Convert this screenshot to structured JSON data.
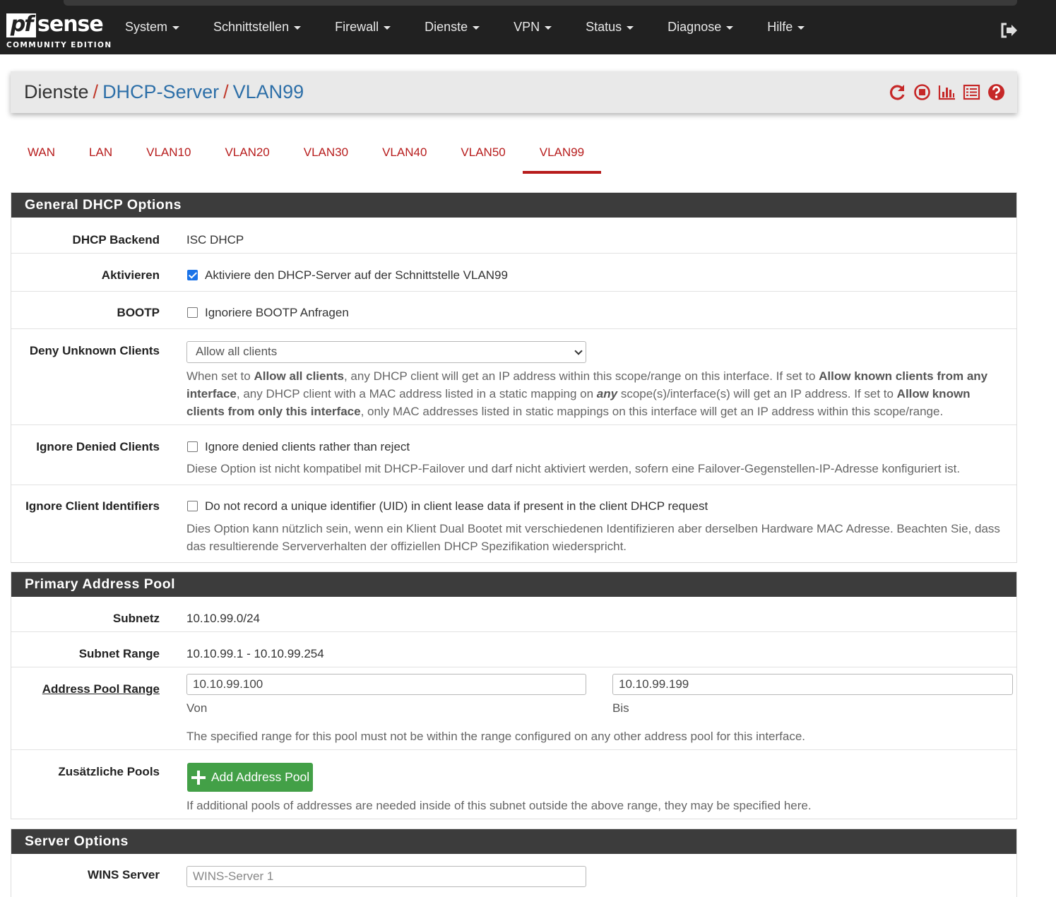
{
  "brand": {
    "logo_pf": "pf",
    "logo_sense": "sense",
    "edition": "COMMUNITY EDITION"
  },
  "nav": [
    "System",
    "Schnittstellen",
    "Firewall",
    "Dienste",
    "VPN",
    "Status",
    "Diagnose",
    "Hilfe"
  ],
  "breadcrumb": {
    "root": "Dienste",
    "section": "DHCP-Server",
    "page": "VLAN99",
    "separator": "/"
  },
  "header_icons": [
    "restart-service-icon",
    "stop-service-icon",
    "graph-icon",
    "logs-icon",
    "help-icon"
  ],
  "tabs": [
    "WAN",
    "LAN",
    "VLAN10",
    "VLAN20",
    "VLAN30",
    "VLAN40",
    "VLAN50",
    "VLAN99"
  ],
  "active_tab": "VLAN99",
  "general": {
    "title": "General DHCP Options",
    "backend_label": "DHCP Backend",
    "backend_value": "ISC DHCP",
    "enable_label": "Aktivieren",
    "enable_text": "Aktiviere den DHCP-Server auf der Schnittstelle VLAN99",
    "enable_checked": true,
    "bootp_label": "BOOTP",
    "bootp_text": "Ignoriere BOOTP Anfragen",
    "bootp_checked": false,
    "deny_label": "Deny Unknown Clients",
    "deny_selected": "Allow all clients",
    "deny_help": {
      "t1": "When set to ",
      "b1": "Allow all clients",
      "t2": ", any DHCP client will get an IP address within this scope/range on this interface. If set to ",
      "b2": "Allow known clients from any interface",
      "t3": ", any DHCP client with a MAC address listed in a static mapping on ",
      "b3": "any",
      "t4": " scope(s)/interface(s) will get an IP address. If set to ",
      "b4": "Allow known clients from only this interface",
      "t5": ", only MAC addresses listed in static mappings on this interface will get an IP address within this scope/range."
    },
    "ignore_denied_label": "Ignore Denied Clients",
    "ignore_denied_text": "Ignore denied clients rather than reject",
    "ignore_denied_checked": false,
    "ignore_denied_help": "Diese Option ist nicht kompatibel mit DHCP-Failover und darf nicht aktiviert werden, sofern eine Failover-Gegenstellen-IP-Adresse konfiguriert ist.",
    "ignore_uid_label": "Ignore Client Identifiers",
    "ignore_uid_text": "Do not record a unique identifier (UID) in client lease data if present in the client DHCP request",
    "ignore_uid_checked": false,
    "ignore_uid_help_1": "Dies Option kann nützlich sein, wenn ein Klient Dual Bootet mit verschiedenen Identifizieren aber derselben Hardware MAC Adresse. Beachten Sie, dass",
    "ignore_uid_help_2": "das resultierende Serververhalten der offiziellen DHCP Spezifikation wiederspricht."
  },
  "pool": {
    "title": "Primary Address Pool",
    "subnet_label": "Subnetz",
    "subnet_value": "10.10.99.0/24",
    "range_label": "Subnet Range",
    "range_value": "10.10.99.1 - 10.10.99.254",
    "pool_label": "Address Pool Range",
    "from_value": "10.10.99.100",
    "from_caption": "Von",
    "to_value": "10.10.99.199",
    "to_caption": "Bis",
    "pool_help": "The specified range for this pool must not be within the range configured on any other address pool for this interface.",
    "extra_label": "Zusätzliche Pools",
    "add_button": "Add Address Pool",
    "extra_help": "If additional pools of addresses are needed inside of this subnet outside the above range, they may be specified here."
  },
  "server": {
    "title": "Server Options",
    "wins_label": "WINS Server",
    "wins_placeholder": "WINS-Server 1"
  },
  "colors": {
    "accent": "#b71c1c",
    "link": "#2d6fa8",
    "panel_head": "#3c3c3c",
    "button": "#43a047",
    "navbar": "#212121"
  }
}
